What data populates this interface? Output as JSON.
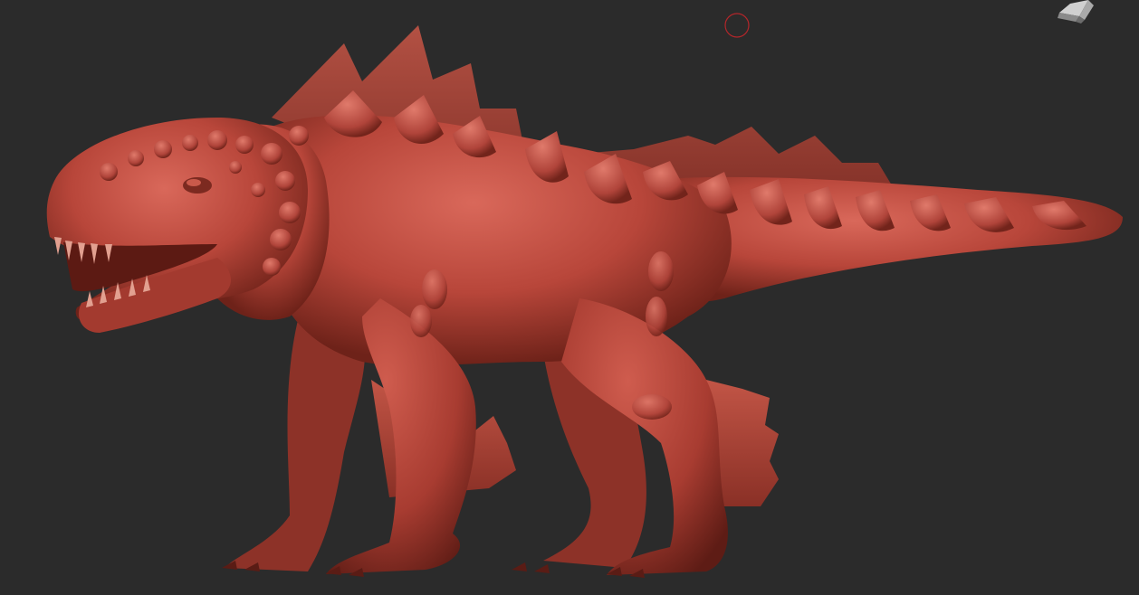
{
  "app": {
    "viewport": {
      "background": "#2b2b2b",
      "model": {
        "subject": "quadruped-dinosaur-sculpt",
        "material_color": "#b8463a",
        "shadow_color": "#6e2219",
        "highlight_color": "#d9685a"
      },
      "brush_cursor": {
        "color": "#b3262a"
      },
      "navigation_cube": {
        "color": "#c9c9c9"
      }
    }
  }
}
